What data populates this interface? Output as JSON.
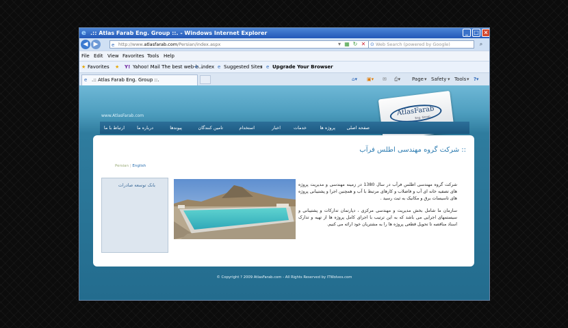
{
  "window": {
    "title": ".:: Atlas Farab Eng. Group ::. - Windows Internet Explorer",
    "address": "http://www.atlasfarab.com/Persian/index.aspx",
    "address_prefix": "http://www.",
    "address_domain": "atlasfarab.com",
    "address_path": "/Persian/index.aspx",
    "search_placeholder": "Web Search (powered by Google)"
  },
  "menu": {
    "file": "File",
    "edit": "Edit",
    "view": "View",
    "favorites": "Favorites",
    "tools": "Tools",
    "help": "Help"
  },
  "favbar": {
    "favorites": "Favorites",
    "yahoo": "Yahoo! Mail The best web-b...",
    "index": "index",
    "suggested": "Suggested Sites",
    "upgrade": "Upgrade Your Browser"
  },
  "tabs": {
    "active": ".:: Atlas Farab Eng. Group ::."
  },
  "commandbar": {
    "page": "Page",
    "safety": "Safety",
    "tools": "Tools"
  },
  "site": {
    "url": "www.AtlasFarab.com",
    "logo": "AtlasFarab",
    "logo_sub": "Eng. Group",
    "nav": [
      "صفحه اصلی",
      "پروژه ها",
      "خدمات",
      "اخبار",
      "استخدام",
      "تامین کنندگان",
      "پیوندها",
      "درباره ما",
      "ارتباط با ما"
    ],
    "heading": ":: شرکت گروه مهندسی اطلس فرآب",
    "lang_persian": "Persian",
    "lang_english": "English",
    "sidebox_title": "بانک توسعه صادرات",
    "paragraph1": "شرکت گروه مهندسی اطلس فرآب در سال 1380 در زمینه مهندسی و مدیریت پروژه های تصفیه خانه ای آب و فاضلاب و کارهای مرتبط با آب و همچنین اجرا و پشتیبانی پروژه های تاسیسات برق و مکانیک به ثبت رسید .",
    "paragraph2": "سازمان ما شامل بخش مدیریت و مهندسی مرکزی ، دپارتمان تدارکات و پشتیبانی و سیستمهای اجرایی می باشد که به این ترتیب با اجرای کامل پروژه ها از تهیه و تدارک اسناد مناقصه تا تحویل قطعی پروژه ها را به مشتریان خود ارائه می کنیم.",
    "footer": "© Copyright ? 2009 AtlasFarab.com - All Rights Reserved by ITWolves.com"
  },
  "colors": {
    "titlebar": "#2358b8",
    "page_blue": "#2f7c9e",
    "heading": "#2a7ab0"
  }
}
